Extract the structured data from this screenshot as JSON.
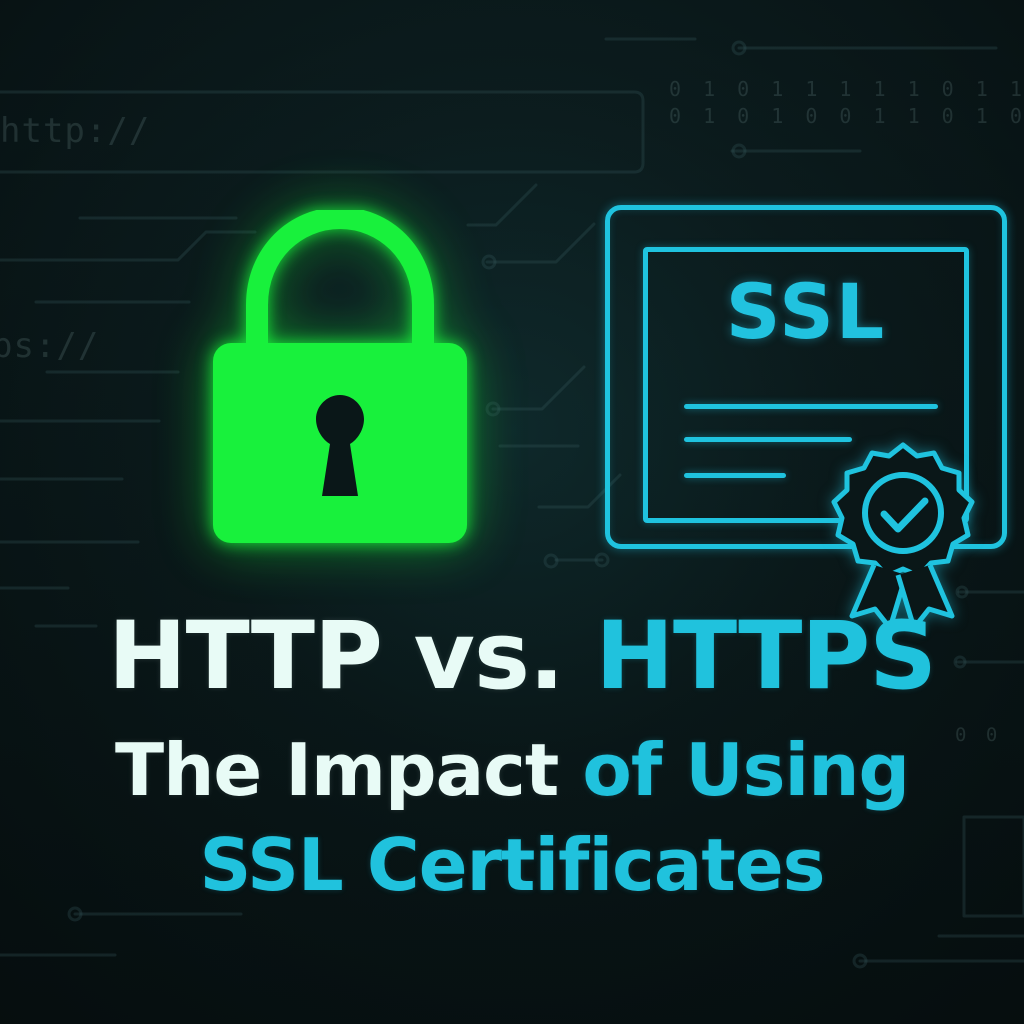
{
  "background": {
    "http_text": "http://",
    "https_text": "ps://",
    "binary_lines": [
      "0 1 0 1 1 1 1 1 0 1 1",
      "0 1 0 1 0 0 1 1 0 1 0",
      "0 0"
    ]
  },
  "graphics": {
    "lock_icon_name": "padlock-icon",
    "certificate_icon_name": "ssl-certificate-icon",
    "certificate_label": "SSL",
    "lock_color": "#18f13c",
    "accent_color": "#1fc3df"
  },
  "title": {
    "line1_left": "HTTP vs.",
    "line1_right": "HTTPS",
    "line2_left": "The Impact",
    "line2_right": "of Using",
    "line3": "SSL Certificates"
  }
}
